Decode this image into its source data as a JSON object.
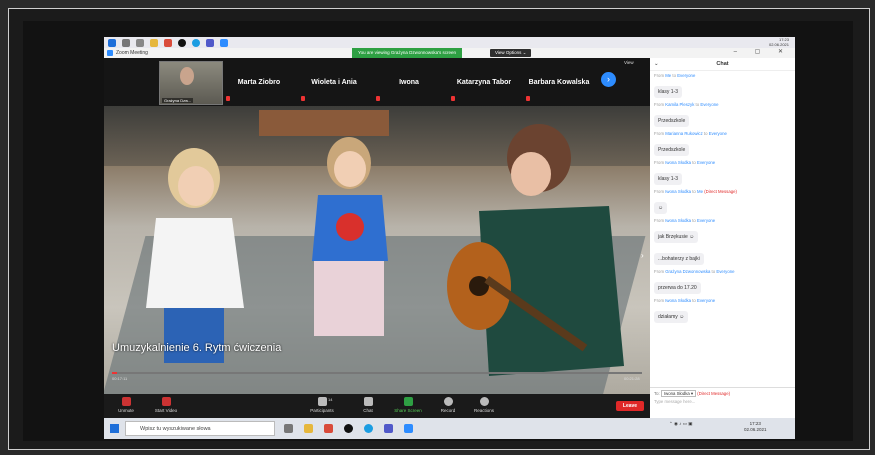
{
  "top_taskbar": {
    "clock_time": "17:23",
    "clock_date": "02.06.2021"
  },
  "zoom": {
    "window_title": "Zoom Meeting",
    "viewing_banner": "You are viewing Grażyna Dzwonnowska's screen",
    "view_options": "View Options ⌄",
    "view_button": "View"
  },
  "participants": {
    "self_name": "Grażyna Dzw...",
    "tiles": [
      {
        "name": "Marta Ziobro"
      },
      {
        "name": "Wioleta i Ania"
      },
      {
        "name": "Iwona"
      },
      {
        "name": "Katarzyna Tabor"
      },
      {
        "name": "Barbara Kowalska"
      }
    ]
  },
  "video": {
    "caption": "Umuzykalnienie 6. Rytm ćwiczenia",
    "time_elapsed": "00:17:11",
    "time_total": "00:21:28",
    "progress": 0.01
  },
  "controls": {
    "unmute": "Unmute",
    "start_video": "Start Video",
    "participants": "Participants",
    "participants_count": "14",
    "chat": "Chat",
    "share_screen": "Share Screen",
    "record": "Record",
    "reactions": "Reactions",
    "leave": "Leave"
  },
  "chat": {
    "title": "Chat",
    "messages": [
      {
        "from": "Me",
        "to": "Everyone",
        "dm": "",
        "text": "klasy 1-3"
      },
      {
        "from": "Kamila Pleszyk",
        "to": "Everyone",
        "dm": "",
        "text": "Przedszkole"
      },
      {
        "from": "Marianna Rukowicz",
        "to": "Everyone",
        "dm": "",
        "text": "Przedszkole"
      },
      {
        "from": "Iwona Słodka",
        "to": "Everyone",
        "dm": "",
        "text": "klasy 1-3"
      },
      {
        "from": "Iwona Słodka",
        "to": "Me",
        "dm": "(Direct Message)",
        "text": "☺"
      },
      {
        "from": "Iwona Słodka",
        "to": "Everyone",
        "dm": "",
        "text": "jak Brzękusie ☺"
      },
      {
        "from": "",
        "to": "",
        "dm": "",
        "text": "...bohaterzy z  bajki"
      },
      {
        "from": "Grażyna Dzwonnowska",
        "to": "Everyone",
        "dm": "",
        "text": "przerwa do 17.20"
      },
      {
        "from": "Iwona Słodka",
        "to": "Everyone",
        "dm": "",
        "text": "działamy ☺"
      }
    ],
    "to_label": "To:",
    "to_value": "Iwona Słodka ▾",
    "to_dm": "(Direct Message)",
    "placeholder": "Type message here..."
  },
  "bottom_taskbar": {
    "search_placeholder": "Wpisz tu wyszukiwane słowa",
    "clock_time": "17:23",
    "clock_date": "02.06.2021"
  }
}
